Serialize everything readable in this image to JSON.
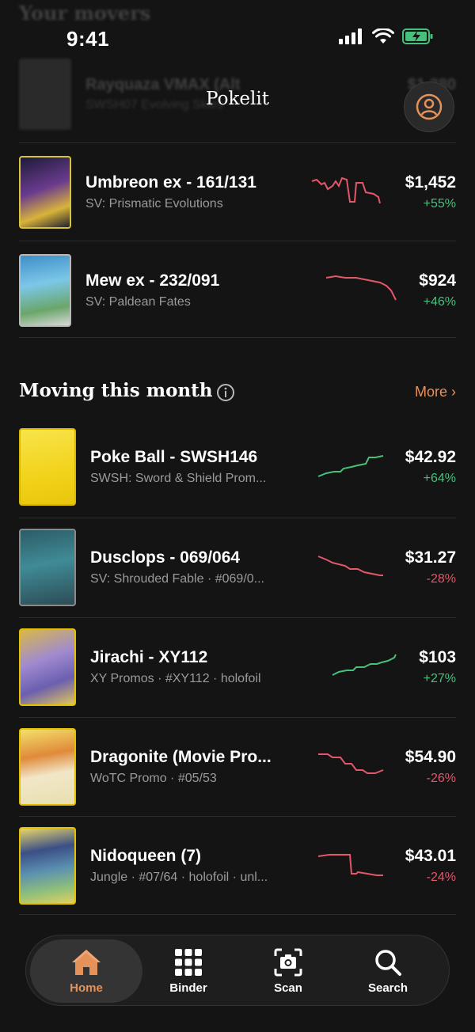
{
  "status": {
    "time": "9:41"
  },
  "header": {
    "title": "Pokelit"
  },
  "faded": {
    "section": "Your movers",
    "name": "Rayquaza VMAX (Alt",
    "sub": "SWSH07 Evolving Skies",
    "price": "$1,380"
  },
  "movers": [
    {
      "name": "Umbreon ex - 161/131",
      "sub": "SV: Prismatic Evolutions",
      "price": "$1,452",
      "change": "+55%",
      "trend": "down"
    },
    {
      "name": "Mew ex - 232/091",
      "sub": "SV: Paldean Fates",
      "price": "$924",
      "change": "+46%",
      "trend": "down"
    }
  ],
  "moving_section": {
    "title": "Moving this month",
    "more": "More ›"
  },
  "moving": [
    {
      "name": "Poke Ball - SWSH146",
      "sub": "SWSH: Sword & Shield Prom...",
      "price": "$42.92",
      "change": "+64%",
      "trend": "up"
    },
    {
      "name": "Dusclops - 069/064",
      "sub": "SV: Shrouded Fable · #069/0...",
      "price": "$31.27",
      "change": "-28%",
      "trend": "down"
    },
    {
      "name": "Jirachi - XY112",
      "sub": "XY Promos · #XY112 · holofoil",
      "price": "$103",
      "change": "+27%",
      "trend": "up"
    },
    {
      "name": "Dragonite (Movie Pro...",
      "sub": "WoTC Promo · #05/53",
      "price": "$54.90",
      "change": "-26%",
      "trend": "down"
    },
    {
      "name": "Nidoqueen (7)",
      "sub": "Jungle · #07/64 · holofoil · unl...",
      "price": "$43.01",
      "change": "-24%",
      "trend": "down"
    }
  ],
  "tabs": [
    {
      "label": "Home",
      "icon": "home-icon",
      "active": true
    },
    {
      "label": "Binder",
      "icon": "grid-icon",
      "active": false
    },
    {
      "label": "Scan",
      "icon": "camera-scan-icon",
      "active": false
    },
    {
      "label": "Search",
      "icon": "search-icon",
      "active": false
    }
  ],
  "colors": {
    "accent": "#e5925a",
    "up": "#47c07b",
    "down": "#e2576a",
    "background": "#141414"
  }
}
